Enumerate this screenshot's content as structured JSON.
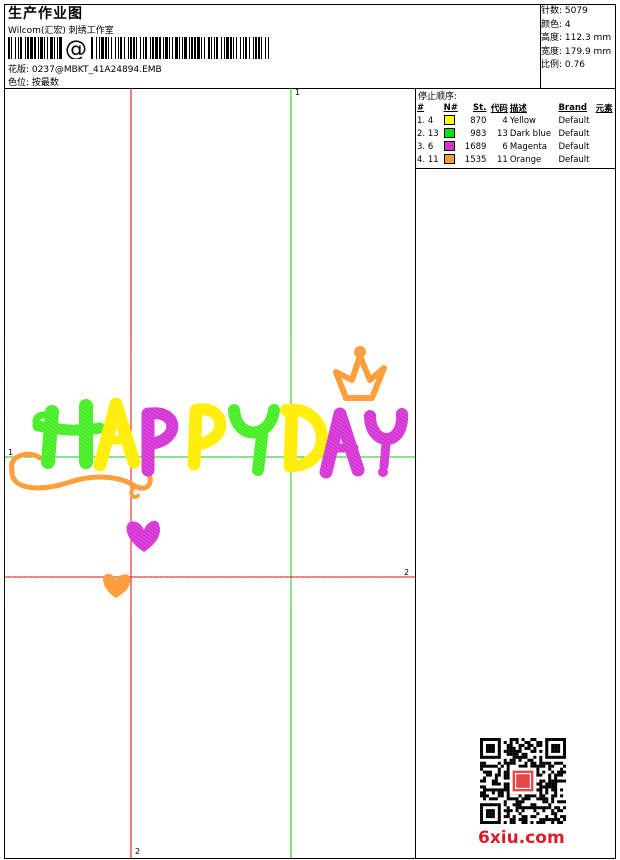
{
  "header": {
    "title": "生产作业图",
    "studio": "Wilcom(汇宏) 刺绣工作室",
    "barcode_symbol": "@",
    "file_label": "花版:",
    "file_name": "0237@MBKT_41A24894.EMB",
    "color_label": "色位:",
    "color_value": "按最数"
  },
  "stats": [
    {
      "label": "针数:",
      "value": "5079"
    },
    {
      "label": "颜色:",
      "value": "4"
    },
    {
      "label": "高度:",
      "value": "112.3 mm"
    },
    {
      "label": "宽度:",
      "value": "179.9 mm"
    },
    {
      "label": "比例:",
      "value": "0.76"
    }
  ],
  "stop_sequence": {
    "title": "停止顺序:",
    "columns": [
      "#",
      "N#",
      "St.",
      "代码",
      "描述",
      "Brand",
      "元素"
    ],
    "rows": [
      {
        "idx": "1.",
        "needle": "4",
        "color": "#ffff00",
        "stitches": "870",
        "code": "4",
        "desc": "Yellow",
        "brand": "Default"
      },
      {
        "idx": "2.",
        "needle": "13",
        "color": "#00e600",
        "stitches": "983",
        "code": "13",
        "desc": "Dark blue",
        "brand": "Default"
      },
      {
        "idx": "3.",
        "needle": "6",
        "color": "#d633cc",
        "stitches": "1689",
        "code": "6",
        "desc": "Magenta",
        "brand": "Default"
      },
      {
        "idx": "4.",
        "needle": "11",
        "color": "#ff9933",
        "stitches": "1535",
        "code": "11",
        "desc": "Orange",
        "brand": "Default"
      }
    ]
  },
  "guides": {
    "green_top": "1",
    "green_left": "1",
    "red_right": "2",
    "red_bottom": "2"
  },
  "design": {
    "text": "HAPPYDAY",
    "colors": {
      "yellow": "#ffee00",
      "green": "#44ee22",
      "magenta": "#d633d6",
      "orange": "#ff9a33",
      "guide_green": "#00cc00",
      "guide_red": "#e00000"
    }
  },
  "watermark": "6xiu.com"
}
